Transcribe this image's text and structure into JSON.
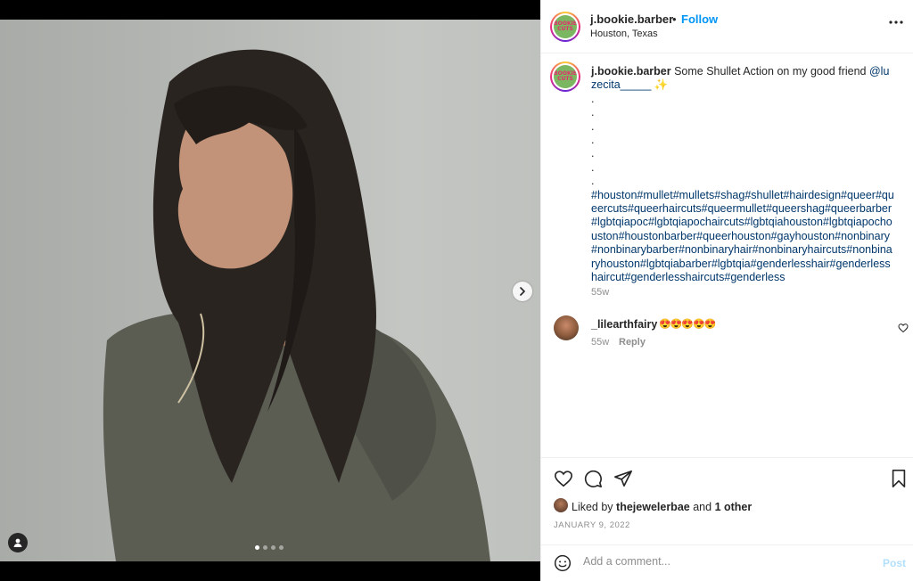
{
  "post": {
    "username": "j.bookie.barber",
    "separator": "•",
    "follow_label": "Follow",
    "location": "Houston, Texas",
    "avatar_logo_text": "BOOKIE CUTS",
    "more_icon": "more-horizontal-icon"
  },
  "caption": {
    "username": "j.bookie.barber",
    "text": "Some Shullet Action on my good friend",
    "mention": "@luzecita_____",
    "sparkle": "✨",
    "bullets": [
      ".",
      ".",
      ".",
      ".",
      ".",
      ".",
      "."
    ],
    "hashtags": "#houston#mullet#mullets#shag#shullet#hairdesign#queer#queercuts#queerhaircuts#queermullet#queershag#queerbarber#lgbtqiapoc#lgbtqiapochaircuts#lgbtqiahouston#lgbtqiapochouston#houstonbarber#queerhouston#gayhouston#nonbinary#nonbinarybarber#nonbinaryhair#nonbinaryhaircuts#nonbinaryhouston#lgbtqiabarber#lgbtqia#genderlesshair#genderlesshaircut#genderlesshaircuts#genderless",
    "time": "55w"
  },
  "comment": {
    "username": "_lilearthfairy",
    "text": "😍😍😍😍😍",
    "time": "55w",
    "reply_label": "Reply"
  },
  "likes": {
    "prefix": "Liked by",
    "user": "thejewelerbae",
    "and": "and",
    "others": "1 other"
  },
  "date": "JANUARY 9, 2022",
  "add_comment": {
    "placeholder": "Add a comment...",
    "post_label": "Post"
  },
  "carousel": {
    "slides": 4,
    "active_index": 0
  },
  "colors": {
    "link": "#00376b",
    "follow": "#0095f6",
    "post_disabled": "#b2dffc",
    "muted": "#8e8e8e"
  }
}
